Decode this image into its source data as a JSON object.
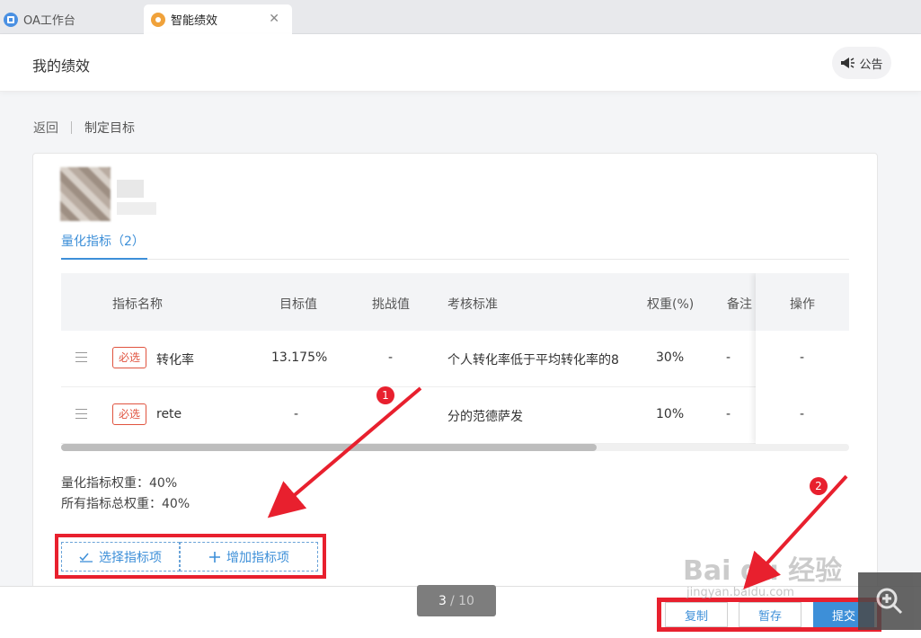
{
  "tabs": [
    {
      "label": "OA工作台"
    },
    {
      "label": "智能绩效"
    }
  ],
  "header": {
    "title": "我的绩效",
    "notice_label": "公告"
  },
  "breadcrumb": {
    "back": "返回",
    "current": "制定目标"
  },
  "subtab": {
    "label": "量化指标（2）"
  },
  "table": {
    "columns": [
      "指标名称",
      "目标值",
      "挑战值",
      "考核标准",
      "权重(%)",
      "备注",
      "操作"
    ],
    "rows": [
      {
        "tag": "必选",
        "name": "转化率",
        "target": "13.175%",
        "challenge": "-",
        "standard": "个人转化率低于平均转化率的8",
        "weight": "30%",
        "remark": "-",
        "op": "-"
      },
      {
        "tag": "必选",
        "name": "rete",
        "target": "-",
        "challenge": "-",
        "standard": "分的范德萨发",
        "weight": "10%",
        "remark": "-",
        "op": "-"
      }
    ]
  },
  "summary": {
    "quant_weight": "量化指标权重：40%",
    "total_weight": "所有指标总权重：40%"
  },
  "actions": {
    "select": "选择指标项",
    "add": "增加指标项"
  },
  "pager": {
    "current": "3",
    "total": "/ 10"
  },
  "footer": {
    "copy": "复制",
    "save": "暂存",
    "submit": "提交"
  },
  "annotations": {
    "badge1": "1",
    "badge2": "2"
  },
  "watermark": {
    "logo": "Bai du 经验",
    "url": "jingyan.baidu.com"
  },
  "colors": {
    "accent": "#3d8fd8",
    "required_tag": "#e0533f",
    "annotation": "#e8202e"
  }
}
